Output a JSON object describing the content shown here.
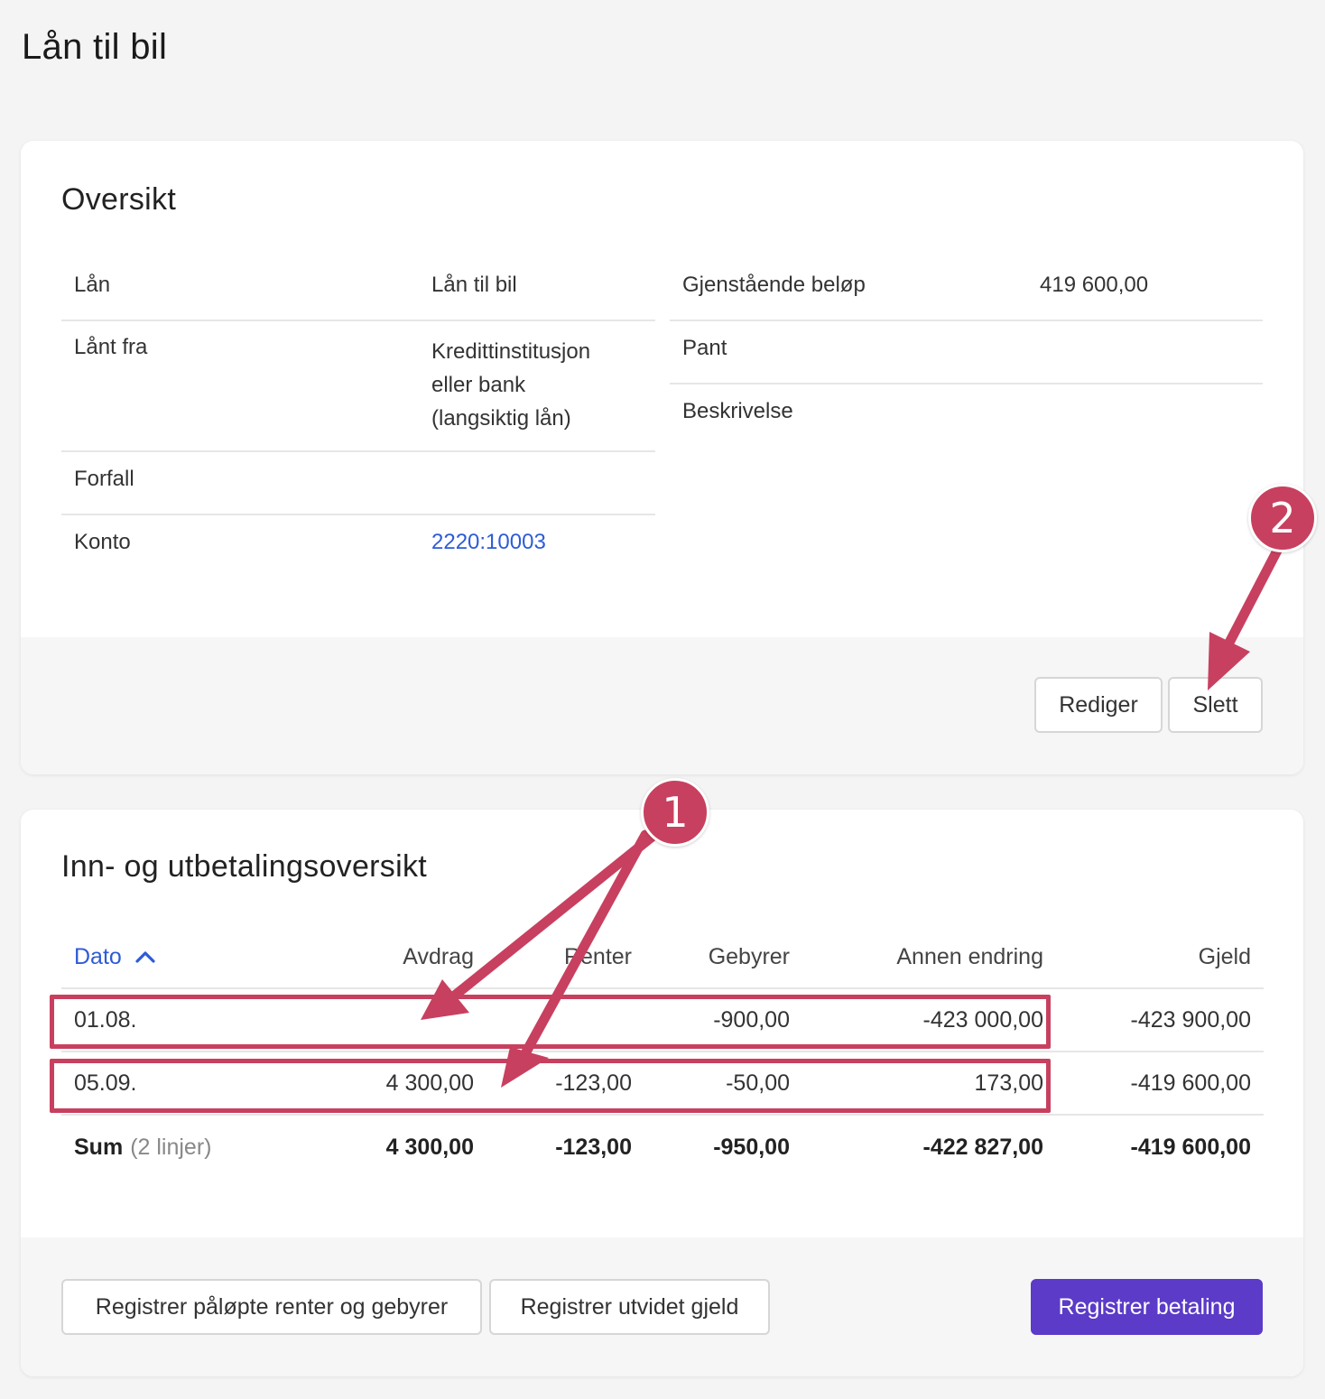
{
  "page": {
    "title": "Lån til bil"
  },
  "overview": {
    "title": "Oversikt",
    "left_rows": [
      {
        "label": "Lån",
        "value": "Lån til bil"
      },
      {
        "label": "Lånt fra",
        "value_lines": [
          "Kredittinstitusjon",
          "eller bank",
          "(langsiktig lån)"
        ]
      },
      {
        "label": "Forfall",
        "value": ""
      },
      {
        "label": "Konto",
        "value": "2220:10003"
      }
    ],
    "right_rows": [
      {
        "label": "Gjenstående beløp",
        "value": "419 600,00"
      },
      {
        "label": "Pant",
        "value": ""
      },
      {
        "label": "Beskrivelse",
        "value": ""
      }
    ],
    "buttons": {
      "edit": "Rediger",
      "delete": "Slett"
    }
  },
  "payments": {
    "title": "Inn- og utbetalingsoversikt",
    "columns": [
      "Dato",
      "Avdrag",
      "Renter",
      "Gebyrer",
      "Annen endring",
      "Gjeld"
    ],
    "rows": [
      {
        "dato": "01.08.",
        "avdrag": "",
        "renter": "",
        "gebyrer": "-900,00",
        "annen": "-423 000,00",
        "gjeld": "-423 900,00"
      },
      {
        "dato": "05.09.",
        "avdrag": "4 300,00",
        "renter": "-123,00",
        "gebyrer": "-50,00",
        "annen": "173,00",
        "gjeld": "-419 600,00"
      }
    ],
    "sum": {
      "label": "Sum",
      "count": "(2 linjer)",
      "avdrag": "4 300,00",
      "renter": "-123,00",
      "gebyrer": "-950,00",
      "annen": "-422 827,00",
      "gjeld": "-419 600,00"
    },
    "buttons": {
      "accrued": "Registrer påløpte renter og gebyrer",
      "extended": "Registrer utvidet gjeld",
      "payment": "Registrer betaling"
    }
  },
  "annotations": {
    "marker1": "1",
    "marker2": "2"
  },
  "colors": {
    "accent": "#5b3bc7",
    "link": "#2e5bd6",
    "annotation": "#c8405f"
  }
}
